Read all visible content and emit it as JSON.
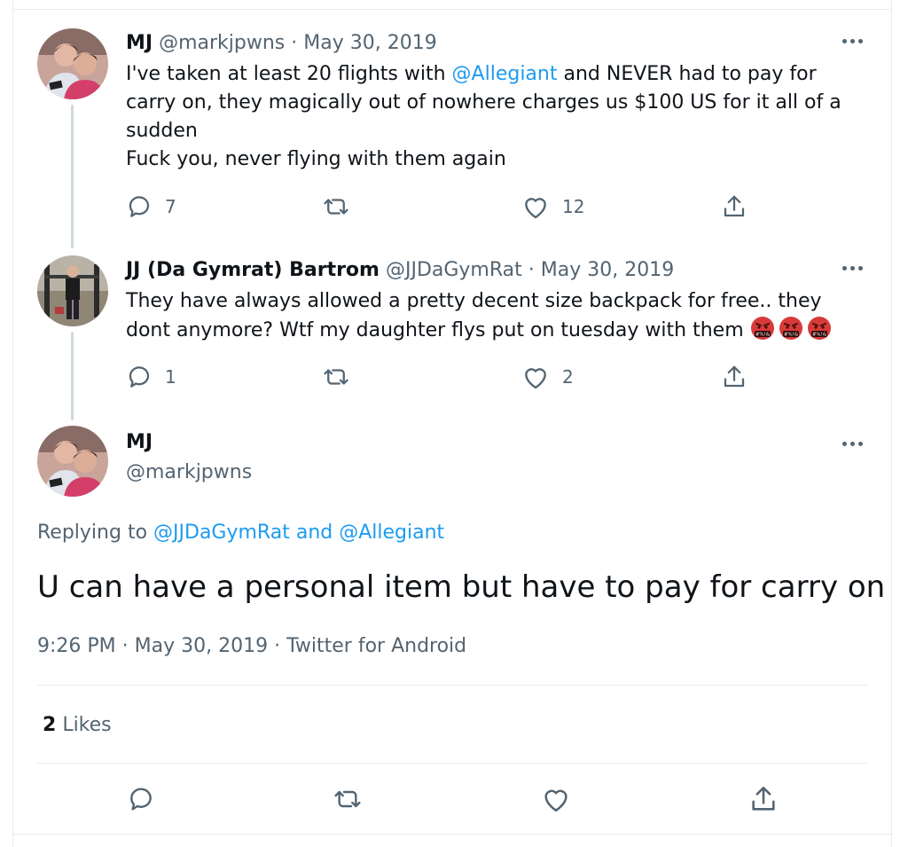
{
  "tweets": [
    {
      "name": "MJ",
      "handle": "@markjpwns",
      "separator": "·",
      "date": "May 30, 2019",
      "text_before": "I've taken at least 20 flights with ",
      "mention": "@Allegiant",
      "text_after": " and NEVER had to pay for carry on, they magically out of nowhere charges us $100 US for it all of a sudden",
      "text_line2": "Fuck you, never flying with them again",
      "reply_count": "7",
      "retweet_count": "",
      "like_count": "12",
      "avatar_icon": "profile-photo"
    },
    {
      "name": "JJ (Da Gymrat) Bartrom",
      "handle": "@JJDaGymRat",
      "separator": "·",
      "date": "May 30, 2019",
      "text": "They have always allowed a pretty decent size backpack for free.. they dont anymore? Wtf my daughter flys put on tuesday with them",
      "emoji_icon": "face-with-symbols-on-mouth",
      "emoji_count": 3,
      "reply_count": "1",
      "retweet_count": "",
      "like_count": "2",
      "avatar_icon": "profile-photo"
    }
  ],
  "main_tweet": {
    "name": "MJ",
    "handle": "@markjpwns",
    "replying_prefix": "Replying to ",
    "replying_mention_1": "@JJDaGymRat",
    "replying_and": " and ",
    "replying_mention_2": "@Allegiant",
    "text": "U can have a personal item but have to pay for carry on",
    "time": "9:26 PM",
    "separator": "·",
    "date": "May 30, 2019",
    "source": "Twitter for Android",
    "likes_count": "2",
    "likes_label": "Likes"
  },
  "colors": {
    "accent": "#1d9bf0",
    "muted": "#536471",
    "text": "#0f1419",
    "divider": "#e6ecf0",
    "emoji_red": "#d83a3a"
  }
}
